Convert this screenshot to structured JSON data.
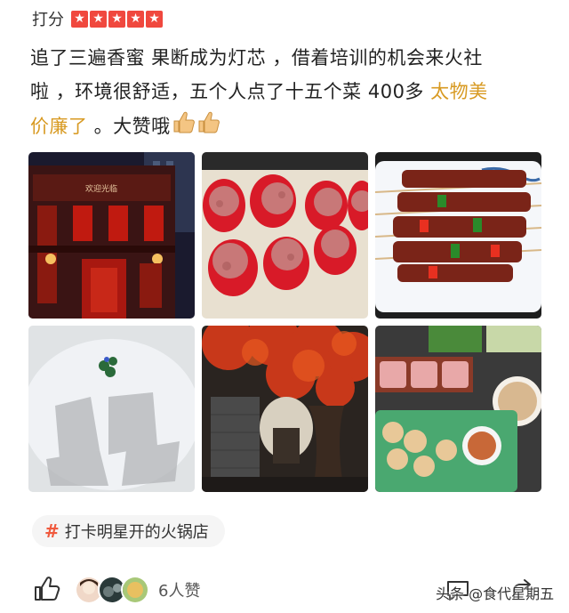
{
  "rating": {
    "label": "打分",
    "stars": 5,
    "star_color": "#f0483e"
  },
  "review": {
    "line1": "追了三遍香蜜 果断成为灯芯 ，借着培训的机会来火社",
    "line2_start": "啦 ，环境很舒适，五个人点了十五个菜 400多 ",
    "line2_highlight": "太物美",
    "line3_highlight": "价廉了",
    "line3_end": " 。大赞哦",
    "highlight_color": "#d89a22"
  },
  "photos": [
    {
      "name": "restaurant-facade-photo",
      "desc": "restaurant exterior"
    },
    {
      "name": "beef-balls-photo",
      "desc": "meat balls"
    },
    {
      "name": "skewers-photo",
      "desc": "skewers"
    },
    {
      "name": "tripe-photo",
      "desc": "tripe with dry ice"
    },
    {
      "name": "interior-tree-photo",
      "desc": "interior with red tree"
    },
    {
      "name": "hotpot-spread-photo",
      "desc": "hotpot spread"
    }
  ],
  "tag": {
    "hash": "#",
    "label": "打卡明星开的火锅店"
  },
  "footer": {
    "likes_count": "6人赞",
    "watermark": "头条 @食代星期五"
  }
}
